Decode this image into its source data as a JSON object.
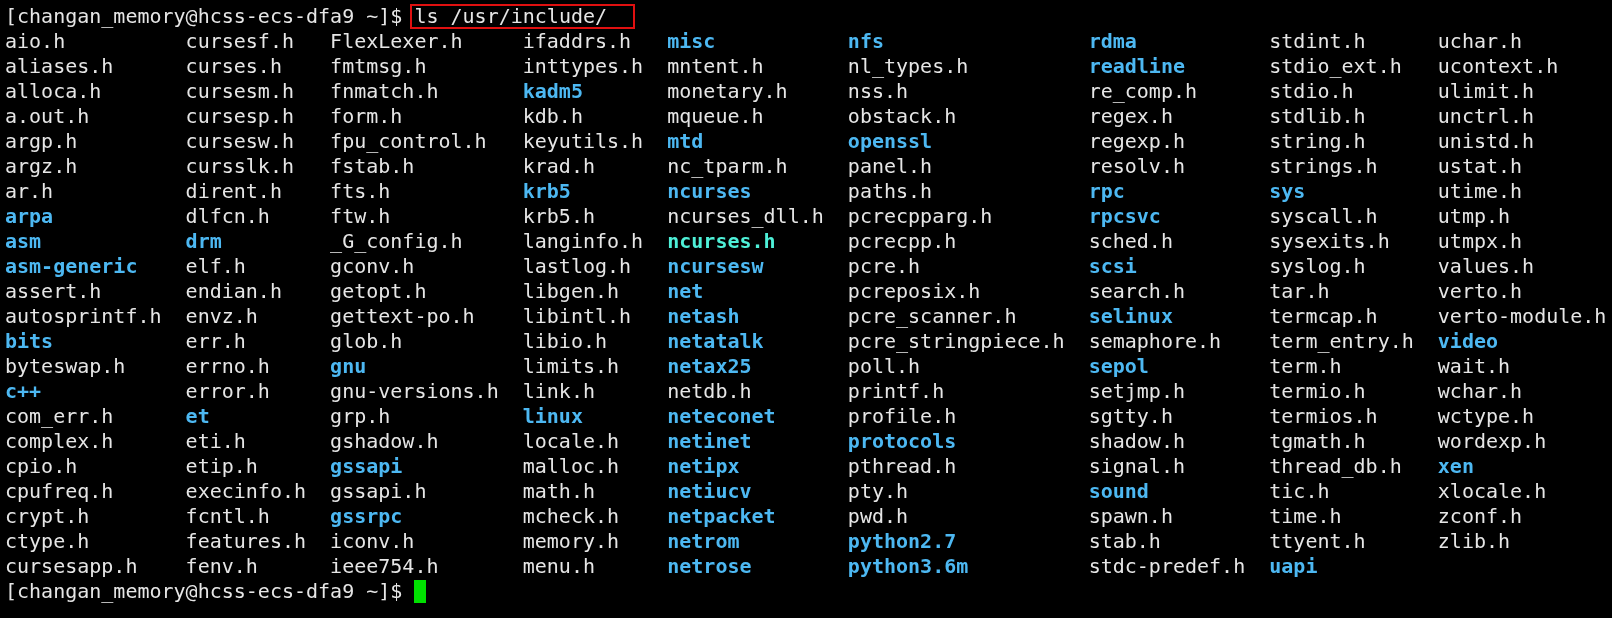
{
  "prompt": {
    "text": "[changan_memory@hcss-ecs-dfa9 ~]$",
    "command": "ls /usr/include/",
    "command_highlighted": true
  },
  "listing": [
    [
      {
        "name": "aio.h",
        "kind": "file"
      },
      {
        "name": "aliases.h",
        "kind": "file"
      },
      {
        "name": "alloca.h",
        "kind": "file"
      },
      {
        "name": "a.out.h",
        "kind": "file"
      },
      {
        "name": "argp.h",
        "kind": "file"
      },
      {
        "name": "argz.h",
        "kind": "file"
      },
      {
        "name": "ar.h",
        "kind": "file"
      },
      {
        "name": "arpa",
        "kind": "dir"
      },
      {
        "name": "asm",
        "kind": "dir"
      },
      {
        "name": "asm-generic",
        "kind": "dir"
      },
      {
        "name": "assert.h",
        "kind": "file"
      },
      {
        "name": "autosprintf.h",
        "kind": "file"
      },
      {
        "name": "bits",
        "kind": "dir"
      },
      {
        "name": "byteswap.h",
        "kind": "file"
      },
      {
        "name": "c++",
        "kind": "dir"
      },
      {
        "name": "com_err.h",
        "kind": "file"
      },
      {
        "name": "complex.h",
        "kind": "file"
      },
      {
        "name": "cpio.h",
        "kind": "file"
      },
      {
        "name": "cpufreq.h",
        "kind": "file"
      },
      {
        "name": "crypt.h",
        "kind": "file"
      },
      {
        "name": "ctype.h",
        "kind": "file"
      },
      {
        "name": "cursesapp.h",
        "kind": "file"
      }
    ],
    [
      {
        "name": "cursesf.h",
        "kind": "file"
      },
      {
        "name": "curses.h",
        "kind": "file"
      },
      {
        "name": "cursesm.h",
        "kind": "file"
      },
      {
        "name": "cursesp.h",
        "kind": "file"
      },
      {
        "name": "cursesw.h",
        "kind": "file"
      },
      {
        "name": "cursslk.h",
        "kind": "file"
      },
      {
        "name": "dirent.h",
        "kind": "file"
      },
      {
        "name": "dlfcn.h",
        "kind": "file"
      },
      {
        "name": "drm",
        "kind": "dir"
      },
      {
        "name": "elf.h",
        "kind": "file"
      },
      {
        "name": "endian.h",
        "kind": "file"
      },
      {
        "name": "envz.h",
        "kind": "file"
      },
      {
        "name": "err.h",
        "kind": "file"
      },
      {
        "name": "errno.h",
        "kind": "file"
      },
      {
        "name": "error.h",
        "kind": "file"
      },
      {
        "name": "et",
        "kind": "dir"
      },
      {
        "name": "eti.h",
        "kind": "file"
      },
      {
        "name": "etip.h",
        "kind": "file"
      },
      {
        "name": "execinfo.h",
        "kind": "file"
      },
      {
        "name": "fcntl.h",
        "kind": "file"
      },
      {
        "name": "features.h",
        "kind": "file"
      },
      {
        "name": "fenv.h",
        "kind": "file"
      }
    ],
    [
      {
        "name": "FlexLexer.h",
        "kind": "file"
      },
      {
        "name": "fmtmsg.h",
        "kind": "file"
      },
      {
        "name": "fnmatch.h",
        "kind": "file"
      },
      {
        "name": "form.h",
        "kind": "file"
      },
      {
        "name": "fpu_control.h",
        "kind": "file"
      },
      {
        "name": "fstab.h",
        "kind": "file"
      },
      {
        "name": "fts.h",
        "kind": "file"
      },
      {
        "name": "ftw.h",
        "kind": "file"
      },
      {
        "name": "_G_config.h",
        "kind": "file"
      },
      {
        "name": "gconv.h",
        "kind": "file"
      },
      {
        "name": "getopt.h",
        "kind": "file"
      },
      {
        "name": "gettext-po.h",
        "kind": "file"
      },
      {
        "name": "glob.h",
        "kind": "file"
      },
      {
        "name": "gnu",
        "kind": "dir"
      },
      {
        "name": "gnu-versions.h",
        "kind": "file"
      },
      {
        "name": "grp.h",
        "kind": "file"
      },
      {
        "name": "gshadow.h",
        "kind": "file"
      },
      {
        "name": "gssapi",
        "kind": "dir"
      },
      {
        "name": "gssapi.h",
        "kind": "file"
      },
      {
        "name": "gssrpc",
        "kind": "dir"
      },
      {
        "name": "iconv.h",
        "kind": "file"
      },
      {
        "name": "ieee754.h",
        "kind": "file"
      }
    ],
    [
      {
        "name": "ifaddrs.h",
        "kind": "file"
      },
      {
        "name": "inttypes.h",
        "kind": "file"
      },
      {
        "name": "kadm5",
        "kind": "dir"
      },
      {
        "name": "kdb.h",
        "kind": "file"
      },
      {
        "name": "keyutils.h",
        "kind": "file"
      },
      {
        "name": "krad.h",
        "kind": "file"
      },
      {
        "name": "krb5",
        "kind": "dir"
      },
      {
        "name": "krb5.h",
        "kind": "file"
      },
      {
        "name": "langinfo.h",
        "kind": "file"
      },
      {
        "name": "lastlog.h",
        "kind": "file"
      },
      {
        "name": "libgen.h",
        "kind": "file"
      },
      {
        "name": "libintl.h",
        "kind": "file"
      },
      {
        "name": "libio.h",
        "kind": "file"
      },
      {
        "name": "limits.h",
        "kind": "file"
      },
      {
        "name": "link.h",
        "kind": "file"
      },
      {
        "name": "linux",
        "kind": "dir"
      },
      {
        "name": "locale.h",
        "kind": "file"
      },
      {
        "name": "malloc.h",
        "kind": "file"
      },
      {
        "name": "math.h",
        "kind": "file"
      },
      {
        "name": "mcheck.h",
        "kind": "file"
      },
      {
        "name": "memory.h",
        "kind": "file"
      },
      {
        "name": "menu.h",
        "kind": "file"
      }
    ],
    [
      {
        "name": "misc",
        "kind": "dir"
      },
      {
        "name": "mntent.h",
        "kind": "file"
      },
      {
        "name": "monetary.h",
        "kind": "file"
      },
      {
        "name": "mqueue.h",
        "kind": "file"
      },
      {
        "name": "mtd",
        "kind": "dir"
      },
      {
        "name": "nc_tparm.h",
        "kind": "file"
      },
      {
        "name": "ncurses",
        "kind": "dir"
      },
      {
        "name": "ncurses_dll.h",
        "kind": "file"
      },
      {
        "name": "ncurses.h",
        "kind": "link"
      },
      {
        "name": "ncursesw",
        "kind": "dir"
      },
      {
        "name": "net",
        "kind": "dir"
      },
      {
        "name": "netash",
        "kind": "dir"
      },
      {
        "name": "netatalk",
        "kind": "dir"
      },
      {
        "name": "netax25",
        "kind": "dir"
      },
      {
        "name": "netdb.h",
        "kind": "file"
      },
      {
        "name": "neteconet",
        "kind": "dir"
      },
      {
        "name": "netinet",
        "kind": "dir"
      },
      {
        "name": "netipx",
        "kind": "dir"
      },
      {
        "name": "netiucv",
        "kind": "dir"
      },
      {
        "name": "netpacket",
        "kind": "dir"
      },
      {
        "name": "netrom",
        "kind": "dir"
      },
      {
        "name": "netrose",
        "kind": "dir"
      }
    ],
    [
      {
        "name": "nfs",
        "kind": "dir"
      },
      {
        "name": "nl_types.h",
        "kind": "file"
      },
      {
        "name": "nss.h",
        "kind": "file"
      },
      {
        "name": "obstack.h",
        "kind": "file"
      },
      {
        "name": "openssl",
        "kind": "dir"
      },
      {
        "name": "panel.h",
        "kind": "file"
      },
      {
        "name": "paths.h",
        "kind": "file"
      },
      {
        "name": "pcrecpparg.h",
        "kind": "file"
      },
      {
        "name": "pcrecpp.h",
        "kind": "file"
      },
      {
        "name": "pcre.h",
        "kind": "file"
      },
      {
        "name": "pcreposix.h",
        "kind": "file"
      },
      {
        "name": "pcre_scanner.h",
        "kind": "file"
      },
      {
        "name": "pcre_stringpiece.h",
        "kind": "file"
      },
      {
        "name": "poll.h",
        "kind": "file"
      },
      {
        "name": "printf.h",
        "kind": "file"
      },
      {
        "name": "profile.h",
        "kind": "file"
      },
      {
        "name": "protocols",
        "kind": "dir"
      },
      {
        "name": "pthread.h",
        "kind": "file"
      },
      {
        "name": "pty.h",
        "kind": "file"
      },
      {
        "name": "pwd.h",
        "kind": "file"
      },
      {
        "name": "python2.7",
        "kind": "dir"
      },
      {
        "name": "python3.6m",
        "kind": "dir"
      }
    ],
    [
      {
        "name": "rdma",
        "kind": "dir"
      },
      {
        "name": "readline",
        "kind": "dir"
      },
      {
        "name": "re_comp.h",
        "kind": "file"
      },
      {
        "name": "regex.h",
        "kind": "file"
      },
      {
        "name": "regexp.h",
        "kind": "file"
      },
      {
        "name": "resolv.h",
        "kind": "file"
      },
      {
        "name": "rpc",
        "kind": "dir"
      },
      {
        "name": "rpcsvc",
        "kind": "dir"
      },
      {
        "name": "sched.h",
        "kind": "file"
      },
      {
        "name": "scsi",
        "kind": "dir"
      },
      {
        "name": "search.h",
        "kind": "file"
      },
      {
        "name": "selinux",
        "kind": "dir"
      },
      {
        "name": "semaphore.h",
        "kind": "file"
      },
      {
        "name": "sepol",
        "kind": "dir"
      },
      {
        "name": "setjmp.h",
        "kind": "file"
      },
      {
        "name": "sgtty.h",
        "kind": "file"
      },
      {
        "name": "shadow.h",
        "kind": "file"
      },
      {
        "name": "signal.h",
        "kind": "file"
      },
      {
        "name": "sound",
        "kind": "dir"
      },
      {
        "name": "spawn.h",
        "kind": "file"
      },
      {
        "name": "stab.h",
        "kind": "file"
      },
      {
        "name": "stdc-predef.h",
        "kind": "file"
      }
    ],
    [
      {
        "name": "stdint.h",
        "kind": "file"
      },
      {
        "name": "stdio_ext.h",
        "kind": "file"
      },
      {
        "name": "stdio.h",
        "kind": "file"
      },
      {
        "name": "stdlib.h",
        "kind": "file"
      },
      {
        "name": "string.h",
        "kind": "file"
      },
      {
        "name": "strings.h",
        "kind": "file"
      },
      {
        "name": "sys",
        "kind": "dir"
      },
      {
        "name": "syscall.h",
        "kind": "file"
      },
      {
        "name": "sysexits.h",
        "kind": "file"
      },
      {
        "name": "syslog.h",
        "kind": "file"
      },
      {
        "name": "tar.h",
        "kind": "file"
      },
      {
        "name": "termcap.h",
        "kind": "file"
      },
      {
        "name": "term_entry.h",
        "kind": "file"
      },
      {
        "name": "term.h",
        "kind": "file"
      },
      {
        "name": "termio.h",
        "kind": "file"
      },
      {
        "name": "termios.h",
        "kind": "file"
      },
      {
        "name": "tgmath.h",
        "kind": "file"
      },
      {
        "name": "thread_db.h",
        "kind": "file"
      },
      {
        "name": "tic.h",
        "kind": "file"
      },
      {
        "name": "time.h",
        "kind": "file"
      },
      {
        "name": "ttyent.h",
        "kind": "file"
      },
      {
        "name": "uapi",
        "kind": "dir"
      }
    ],
    [
      {
        "name": "uchar.h",
        "kind": "file"
      },
      {
        "name": "ucontext.h",
        "kind": "file"
      },
      {
        "name": "ulimit.h",
        "kind": "file"
      },
      {
        "name": "unctrl.h",
        "kind": "file"
      },
      {
        "name": "unistd.h",
        "kind": "file"
      },
      {
        "name": "ustat.h",
        "kind": "file"
      },
      {
        "name": "utime.h",
        "kind": "file"
      },
      {
        "name": "utmp.h",
        "kind": "file"
      },
      {
        "name": "utmpx.h",
        "kind": "file"
      },
      {
        "name": "values.h",
        "kind": "file"
      },
      {
        "name": "verto.h",
        "kind": "file"
      },
      {
        "name": "verto-module.h",
        "kind": "file"
      },
      {
        "name": "video",
        "kind": "dir"
      },
      {
        "name": "wait.h",
        "kind": "file"
      },
      {
        "name": "wchar.h",
        "kind": "file"
      },
      {
        "name": "wctype.h",
        "kind": "file"
      },
      {
        "name": "wordexp.h",
        "kind": "file"
      },
      {
        "name": "xen",
        "kind": "dir"
      },
      {
        "name": "xlocale.h",
        "kind": "file"
      },
      {
        "name": "zconf.h",
        "kind": "file"
      },
      {
        "name": "zlib.h",
        "kind": "file"
      }
    ]
  ],
  "final_prompt": {
    "text": "[changan_memory@hcss-ecs-dfa9 ~]$",
    "cursor": true
  }
}
